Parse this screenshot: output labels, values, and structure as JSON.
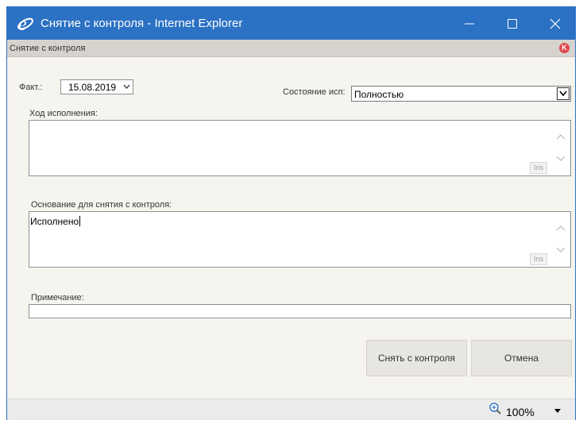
{
  "window": {
    "title": "Снятие с контроля - Internet Explorer",
    "controls": [
      "minimize-icon",
      "maximize-icon",
      "close-icon"
    ],
    "accent_color": "#2b71c4"
  },
  "subheader": {
    "title": "Снятие с контроля",
    "badge": "K",
    "badge_color": "#e0494b"
  },
  "form": {
    "fact_label": "Факт.:",
    "fact_date": "15.08.2019",
    "state_label": "Состояние исп:",
    "state_value": "Полностью",
    "progress_label": "Ход исполнения:",
    "progress_value": "",
    "basis_label": "Основание для снятия с контроля:",
    "basis_value": "Исполнено",
    "ins_label": "Ins",
    "note_label": "Примечание:",
    "note_value": ""
  },
  "buttons": {
    "remove_label": "Снять с контроля",
    "cancel_label": "Отмена"
  },
  "statusbar": {
    "zoom": "100%",
    "zoom_icon": "zoom-magnifier-icon"
  }
}
